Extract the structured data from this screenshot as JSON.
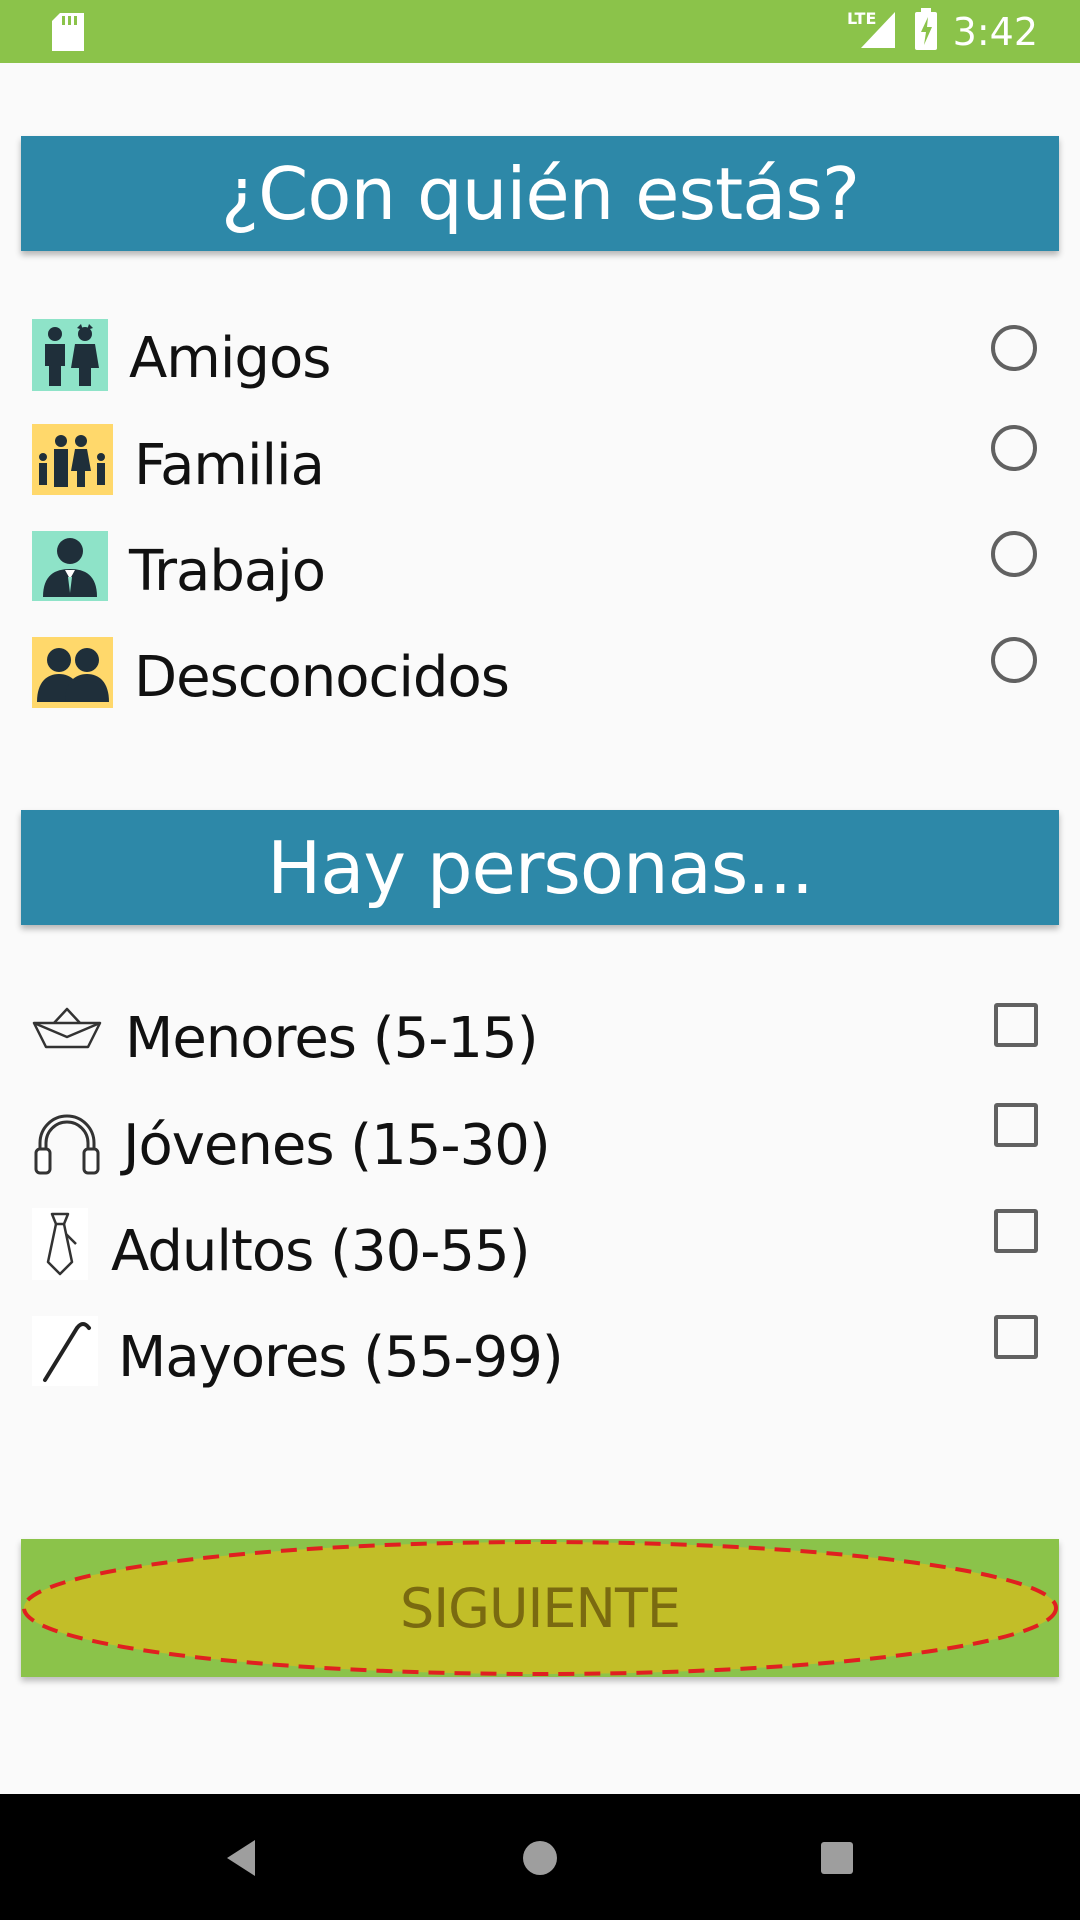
{
  "status_bar": {
    "time": "3:42",
    "network": "LTE",
    "icons": [
      "sd-card-icon",
      "signal-icon",
      "battery-charging-icon"
    ],
    "color": "#8bc34a"
  },
  "section_with": {
    "title": "¿Con quién estás?",
    "options": [
      {
        "label": "Amigos",
        "icon": "friends-icon",
        "selected": false
      },
      {
        "label": "Familia",
        "icon": "family-icon",
        "selected": false
      },
      {
        "label": "Trabajo",
        "icon": "work-icon",
        "selected": false
      },
      {
        "label": "Desconocidos",
        "icon": "strangers-icon",
        "selected": false
      }
    ]
  },
  "section_people": {
    "title": "Hay personas...",
    "options": [
      {
        "label": "Menores (5-15)",
        "icon": "paper-boat-icon",
        "checked": false
      },
      {
        "label": "Jóvenes (15-30)",
        "icon": "headphones-icon",
        "checked": false
      },
      {
        "label": "Adultos (30-55)",
        "icon": "tie-icon",
        "checked": false
      },
      {
        "label": "Mayores (55-99)",
        "icon": "cane-icon",
        "checked": false
      }
    ]
  },
  "next_button": {
    "label": "SIGUIENTE"
  },
  "colors": {
    "header": "#2d88a8",
    "accent_green": "#8bc34a",
    "teal_icon_bg": "#8ee3c8",
    "yellow_icon_bg": "#ffd86b",
    "highlight": "#c2be28",
    "highlight_border": "#e02020"
  },
  "nav_bar": {
    "icons": [
      "back-icon",
      "home-icon",
      "recents-icon"
    ]
  }
}
